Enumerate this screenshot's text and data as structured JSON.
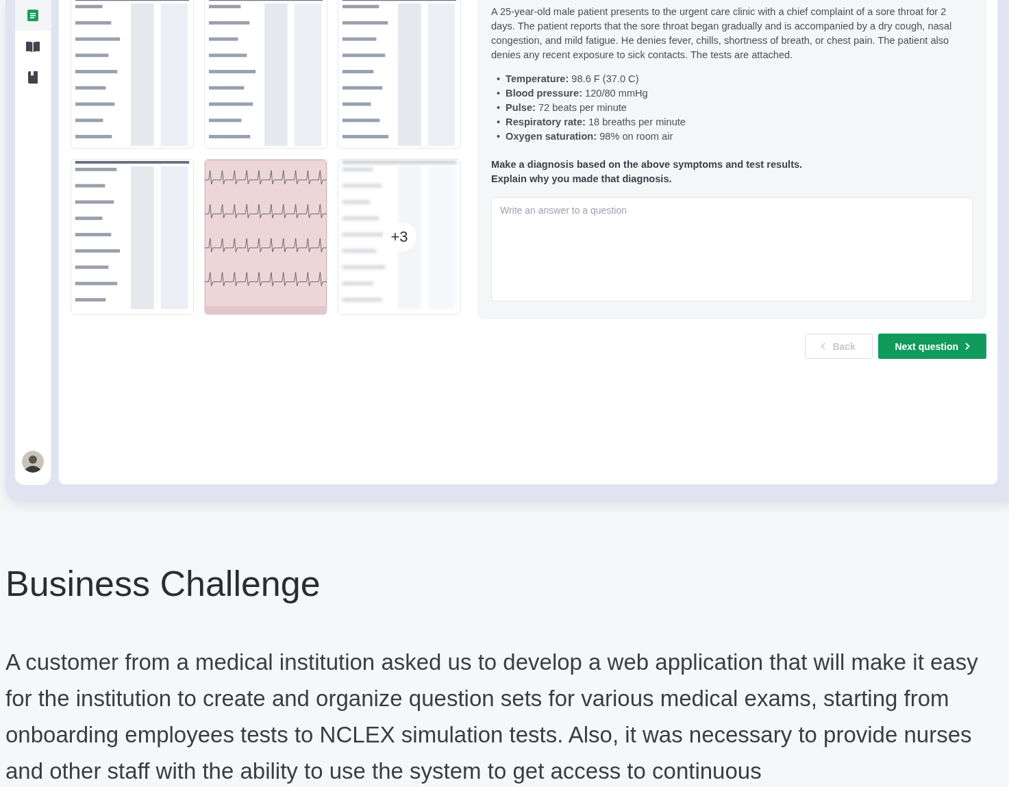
{
  "sidebar": {
    "items": [
      {
        "selected": true
      },
      {
        "selected": false
      },
      {
        "selected": false
      }
    ],
    "avatar": {
      "kind": "avatar"
    }
  },
  "attachments": [
    {
      "kind": "picture"
    },
    {
      "kind": "picture"
    },
    {
      "kind": "picture"
    },
    {
      "kind": "picture"
    },
    {
      "kind": "picture"
    },
    {
      "kind": "picture",
      "more": "+3"
    }
  ],
  "question": {
    "intro": "A 25-year-old male patient presents to the urgent care clinic with a chief complaint of a sore throat for 2 days. The patient reports that the sore throat began gradually and is accompanied by a dry cough, nasal congestion, and mild fatigue. He denies fever, chills, shortness of breath, or chest pain. The patient also denies any recent exposure to sick contacts. The tests are attached.",
    "vitals": [
      {
        "bullet": "•",
        "text": "**Temperature:** 98.6 F (37.0 C)"
      },
      {
        "bullet": "•",
        "text": "**Blood pressure:** 120/80 mmHg"
      },
      {
        "bullet": "•",
        "text": "**Pulse:** 72 beats per minute"
      },
      {
        "bullet": "•",
        "text": "**Respiratory rate:** 18 breaths per minute"
      },
      {
        "bullet": "•",
        "text": "**Oxygen saturation:** 98% on room air"
      }
    ],
    "task": [
      "Make a diagnosis based on the above symptoms and test results.",
      "Explain why you made that diagnosis."
    ],
    "answer": {
      "placeholder": "Write an answer to a question"
    }
  },
  "buttons": [
    {
      "label": "Back",
      "kind": "secondary",
      "disabled": true
    },
    {
      "label": "Next question",
      "kind": "primary",
      "disabled": false
    }
  ],
  "section": {
    "title": "Business Challenge",
    "body": "A customer from a medical institution asked us to develop a web application that will make it easy for the institution to create and organize question sets for various medical exams, starting from onboarding employees tests to NCLEX simulation tests. Also, it was necessary to provide nurses and other staff with the ability to use the system to get access to continuous"
  }
}
